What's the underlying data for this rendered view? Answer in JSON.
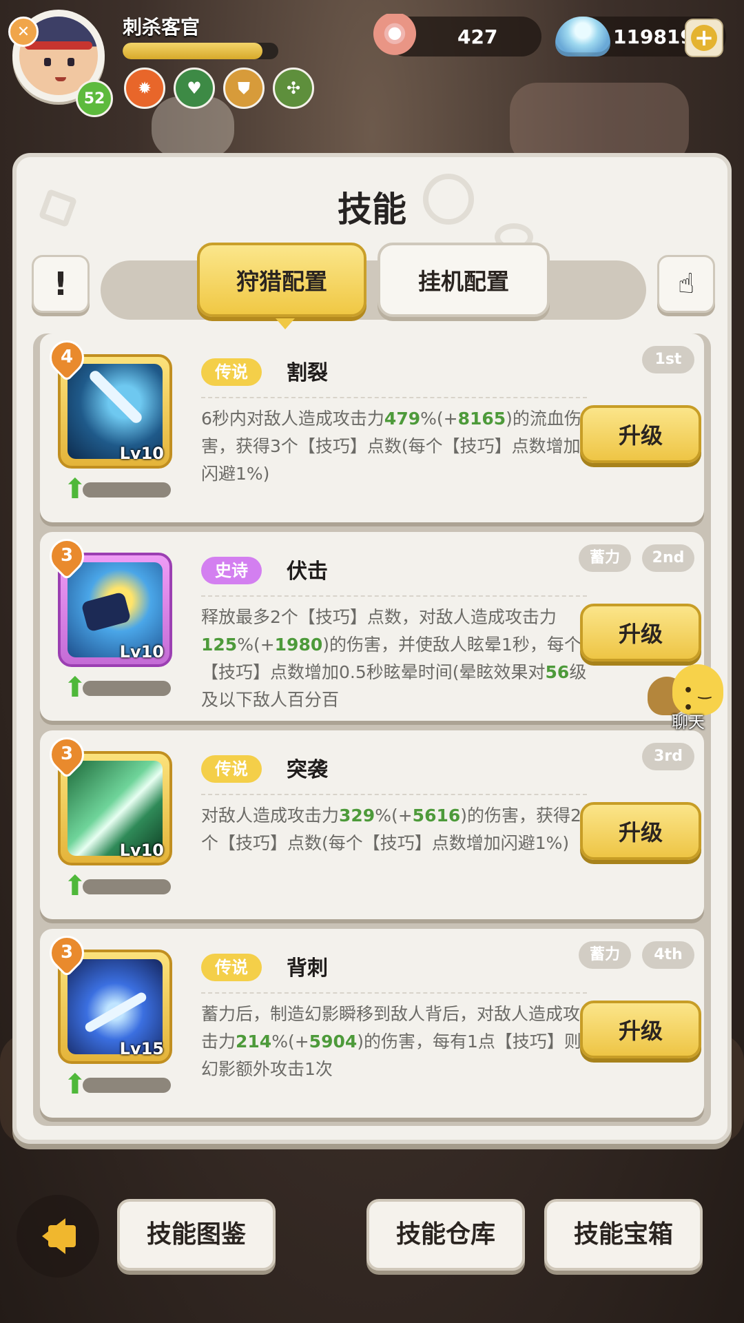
{
  "player": {
    "name": "刺杀客官",
    "level": "52",
    "xp_fraction": 0.9
  },
  "currency": {
    "pearls": "427",
    "shells": "119819"
  },
  "panel": {
    "title": "技能"
  },
  "tabs": [
    {
      "label": "狩猎配置",
      "active": true
    },
    {
      "label": "挂机配置",
      "active": false
    }
  ],
  "skills": [
    {
      "stars": "4",
      "level": "Lv10",
      "rarity": "传说",
      "name": "割裂",
      "rank": "1st",
      "charge": "",
      "desc": [
        "6秒内对敌人造成攻击力",
        "479",
        "%(+",
        "8165",
        ")的流血伤害，获得3个【技巧】点数(每个【技巧】点数增加闪避1%)"
      ],
      "upgrade_label": "升级"
    },
    {
      "stars": "3",
      "level": "Lv10",
      "rarity": "史诗",
      "name": "伏击",
      "rank": "2nd",
      "charge": "蓄力",
      "desc": [
        "释放最多2个【技巧】点数，对敌人造成攻击力",
        "125",
        "%(+",
        "1980",
        ")的伤害，并使敌人眩晕1秒，每个【技巧】点数增加0.5秒眩晕时间(晕眩效果对",
        "56",
        "级及以下敌人百分百"
      ],
      "upgrade_label": "升级"
    },
    {
      "stars": "3",
      "level": "Lv10",
      "rarity": "传说",
      "name": "突袭",
      "rank": "3rd",
      "charge": "",
      "desc": [
        "对敌人造成攻击力",
        "329",
        "%(+",
        "5616",
        ")的伤害，获得2个【技巧】点数(每个【技巧】点数增加闪避1%)"
      ],
      "upgrade_label": "升级"
    },
    {
      "stars": "3",
      "level": "Lv15",
      "rarity": "传说",
      "name": "背刺",
      "rank": "4th",
      "charge": "蓄力",
      "desc": [
        "蓄力后，制造幻影瞬移到敌人背后，对敌人造成攻击力",
        "214",
        "%(+",
        "5904",
        ")的伤害，每有1点【技巧】则幻影额外攻击1次"
      ],
      "upgrade_label": "升级"
    }
  ],
  "chat": {
    "label": "聊天"
  },
  "bottom": {
    "codex": "技能图鉴",
    "warehouse": "技能仓库",
    "chest": "技能宝箱"
  },
  "colors": {
    "gold": "#f0c844",
    "epic": "#d37ff0",
    "highlight_green": "#4d9a3a"
  }
}
